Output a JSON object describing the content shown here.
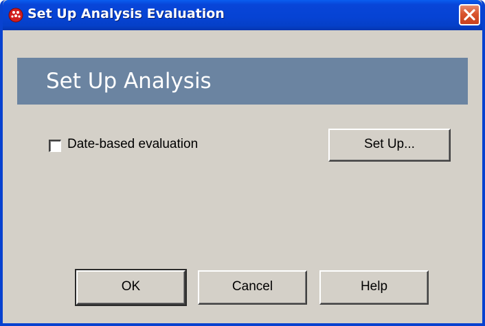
{
  "window": {
    "title": "Set Up Analysis Evaluation",
    "close_label": "×"
  },
  "header": {
    "title": "Set Up Analysis"
  },
  "options": {
    "date_based_label": "Date-based evaluation",
    "date_based_checked": false,
    "setup_button_label": "Set Up..."
  },
  "buttons": {
    "ok_label": "OK",
    "cancel_label": "Cancel",
    "help_label": "Help"
  },
  "colors": {
    "titlebar": "#0643d4",
    "header_band": "#6b84a1",
    "dialog_bg": "#d4d0c8",
    "close_button": "#d9542e"
  },
  "icons": {
    "app": "red-orb-icon",
    "close": "close-icon"
  }
}
